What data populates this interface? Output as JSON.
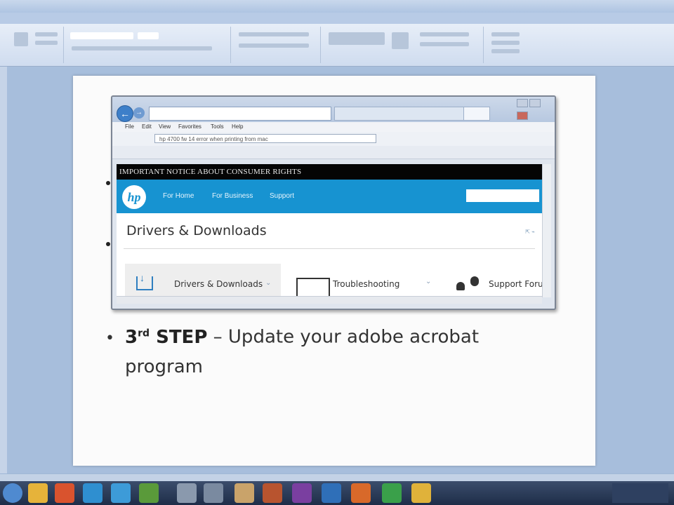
{
  "browser": {
    "menu_items": [
      "File",
      "Edit",
      "View",
      "Favorites",
      "Tools",
      "Help"
    ],
    "search_query": "hp 4700 fw 14 error when printing from mac",
    "notice_banner": "IMPORTANT NOTICE ABOUT CONSUMER RIGHTS",
    "hp": {
      "logo_text": "hp",
      "nav": [
        "For Home",
        "For Business",
        "Support"
      ]
    },
    "page_title": "Drivers & Downloads",
    "categories": [
      "Drivers & Downloads",
      "Troubleshooting",
      "Support Forum"
    ]
  },
  "slide": {
    "bullet": "•",
    "step_num": "3",
    "step_sup": "rd",
    "step_word": "STEP",
    "step_rest": " – Update your adobe acrobat",
    "step_line2": "program"
  }
}
